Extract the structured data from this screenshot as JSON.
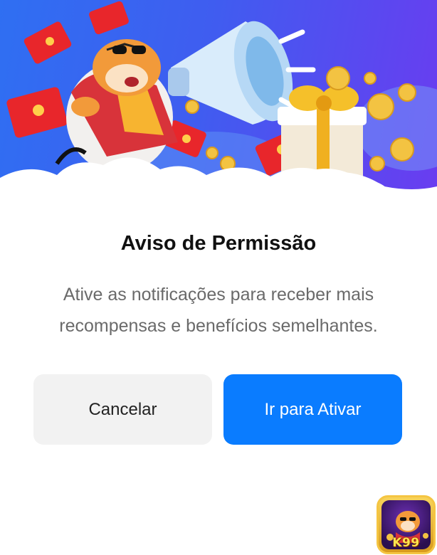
{
  "dialog": {
    "title": "Aviso de Permissão",
    "message": "Ative as notificações para receber mais recompensas e benefícios semelhantes.",
    "cancel_label": "Cancelar",
    "activate_label": "Ir para Ativar"
  },
  "hero": {
    "illustration": "tiger-megaphone-gifts-illustration",
    "colors": {
      "background_start": "#2f6ff2",
      "background_end": "#6a3cf0"
    }
  },
  "app_badge": {
    "label": "K99",
    "icon": "tiger-app-icon"
  },
  "colors": {
    "primary": "#0a7cff",
    "secondary_button": "#f2f2f2",
    "title": "#111111",
    "message": "#6a6a6a"
  }
}
